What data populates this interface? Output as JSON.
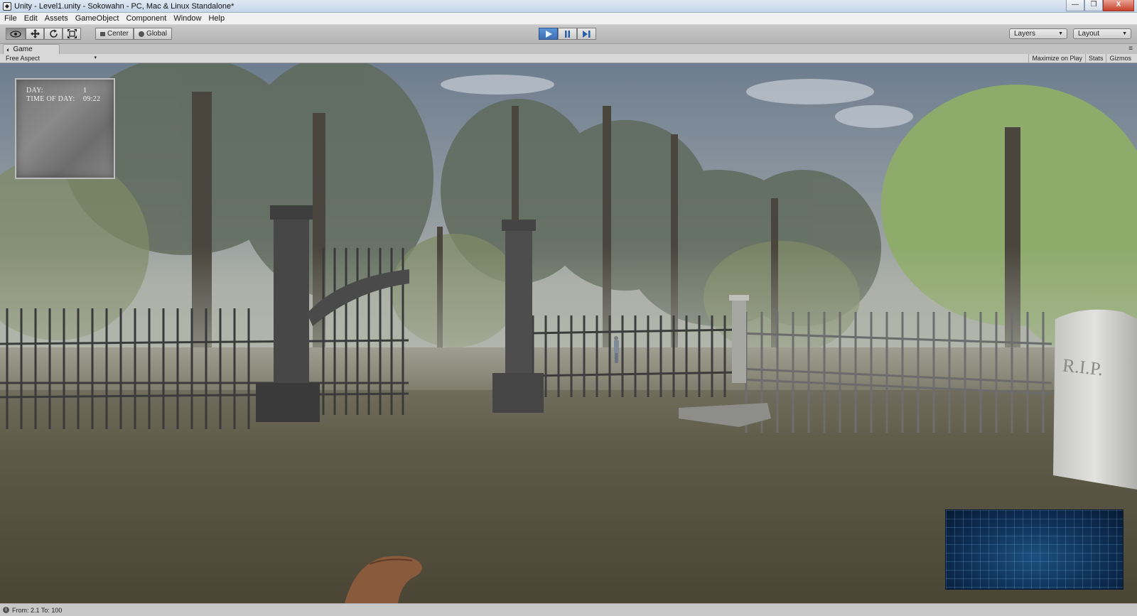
{
  "window": {
    "title": "Unity - Level1.unity - Sokowahn - PC, Mac & Linux Standalone*",
    "controls": [
      "—",
      "❐",
      "X"
    ]
  },
  "menu": [
    "File",
    "Edit",
    "Assets",
    "GameObject",
    "Component",
    "Window",
    "Help"
  ],
  "toolbar": {
    "pivot_label": "Center",
    "space_label": "Global",
    "layers_label": "Layers",
    "layout_label": "Layout"
  },
  "game_tab": {
    "label": "Game",
    "aspect": "Free Aspect",
    "maximize_on_play": "Maximize on Play",
    "stats": "Stats",
    "gizmos": "Gizmos"
  },
  "hud": {
    "day_label": "DAY:",
    "day_value": "1",
    "time_label": "TIME OF DAY:",
    "time_value": "09:22"
  },
  "scene": {
    "tombstone_text": "R.I.P."
  },
  "status": {
    "text": "From: 2.1  To: 100"
  }
}
